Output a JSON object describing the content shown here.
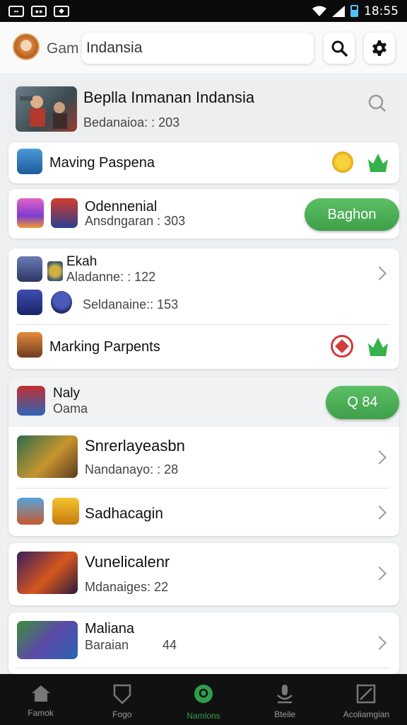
{
  "status_bar": {
    "time": "18:55",
    "icons": [
      "notification-icon-1",
      "notification-icon-2",
      "notification-icon-3",
      "wifi-icon",
      "signal-icon",
      "battery-icon"
    ]
  },
  "header": {
    "label": "Gam",
    "search_value": "Indansia",
    "search_icon": "search-icon",
    "settings_icon": "settings-gear-icon"
  },
  "featured": {
    "title": "Beplla Inmanan Indansia",
    "subtitle": "Bedanaioa: : 203"
  },
  "row_marking": {
    "title": "Maving Paspena",
    "icons": [
      "coin-icon",
      "crown-icon"
    ]
  },
  "row_odenenia": {
    "title": "Odennenial",
    "subtitle": "Ansdngaran : 303",
    "button": "Baghon"
  },
  "group_card": {
    "item1_title": "Ekah",
    "item1_sub": "Aladanne: : 122",
    "item2_sub": "Seldanaine:: 153",
    "item3_title": "Marking Parpents",
    "item3_icons": [
      "shield-badge-icon",
      "crown-icon"
    ]
  },
  "section_card": {
    "header_title": "Naly",
    "header_sub": "Oama",
    "header_button": "Q 84",
    "item1_title": "Snrerlayeasbn",
    "item1_sub": "Nandanayo: : 28",
    "item2_title": "Sadhacagin"
  },
  "vune_card": {
    "title": "Vunelicalenr",
    "subtitle": "Mdanaiges: 22"
  },
  "mala_card": {
    "title": "Maliana",
    "subtitle": "Baraian",
    "value": "44"
  },
  "bottom_nav": [
    {
      "label": "Famok",
      "icon": "home-icon"
    },
    {
      "label": "Fogo",
      "icon": "shield-icon"
    },
    {
      "label": "Namlons",
      "icon": "location-icon"
    },
    {
      "label": "Bteile",
      "icon": "microphone-icon"
    },
    {
      "label": "Acoliamgian",
      "icon": "edit-icon"
    }
  ],
  "colors": {
    "accent_green": "#3e9f49",
    "nav_bg": "#111111",
    "active_nav": "#2e9d4b"
  }
}
